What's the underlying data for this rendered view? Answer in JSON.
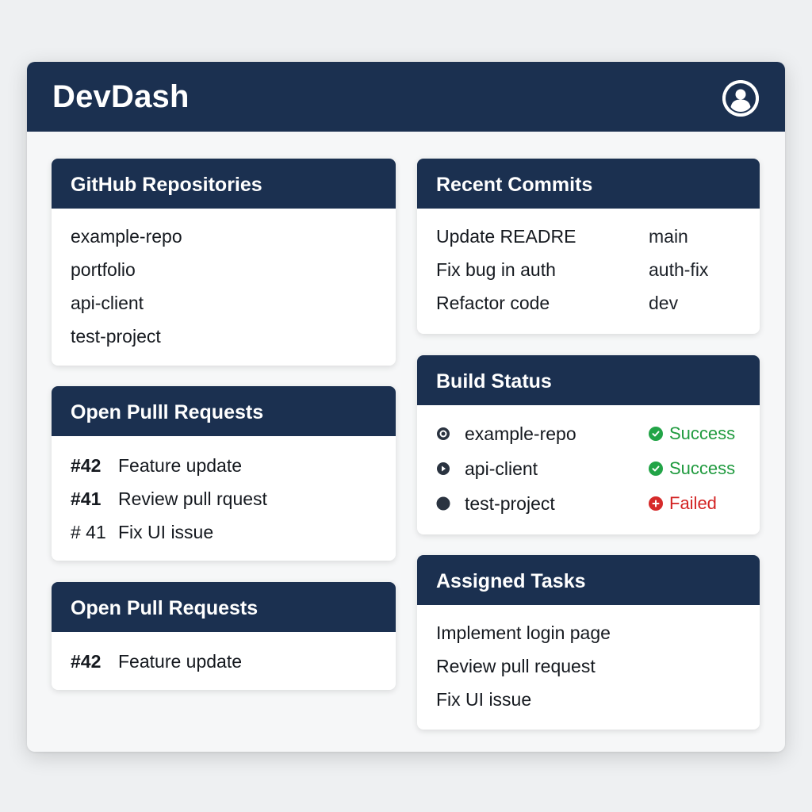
{
  "app": {
    "title": "DevDash"
  },
  "colors": {
    "header": "#1b3050",
    "success": "#1f9a3e",
    "failed": "#d32222"
  },
  "icons": {
    "user": "user-avatar-icon",
    "success": "check-circle-icon",
    "failed": "plus-circle-icon"
  },
  "repositories": {
    "title": "GitHub Repositories",
    "items": [
      "example-repo",
      "portfolio",
      "api-client",
      "test-project"
    ]
  },
  "pull_requests_1": {
    "title": "Open Pulll Requests",
    "items": [
      {
        "number": "#42",
        "title": "Feature update"
      },
      {
        "number": "#41",
        "title": "Review pull rquest"
      },
      {
        "number": "# 41",
        "title": "Fix UI issue"
      }
    ]
  },
  "pull_requests_2": {
    "title": "Open Pull Requests",
    "items": [
      {
        "number": "#42",
        "title": "Feature update"
      }
    ]
  },
  "commits": {
    "title": "Recent Commits",
    "items": [
      {
        "message": "Update READRE",
        "branch": "main"
      },
      {
        "message": "Fix bug in auth",
        "branch": "auth-fix"
      },
      {
        "message": "Refactor code",
        "branch": "dev"
      }
    ]
  },
  "builds": {
    "title": "Build Status",
    "items": [
      {
        "repo": "example-repo",
        "status": "Success"
      },
      {
        "repo": "api-client",
        "status": "Success"
      },
      {
        "repo": "test-project",
        "status": "Failed"
      }
    ]
  },
  "tasks": {
    "title": "Assigned Tasks",
    "items": [
      "Implement login page",
      "Review pull request",
      "Fix UI issue"
    ]
  }
}
